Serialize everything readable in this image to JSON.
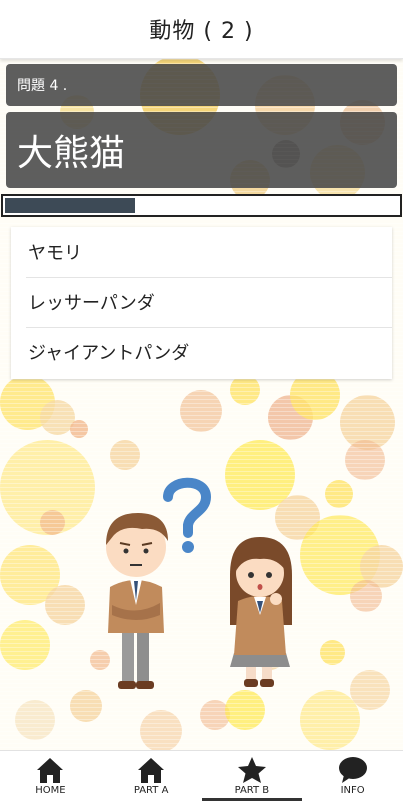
{
  "header": {
    "title": "動物 ( 2 )"
  },
  "quiz": {
    "number_label": "問題 4 .",
    "question": "大熊猫",
    "timer_remaining": 0.33,
    "answers": [
      {
        "label": "ヤモリ"
      },
      {
        "label": "レッサーパンダ"
      },
      {
        "label": "ジャイアントパンダ"
      }
    ]
  },
  "nav": {
    "items": [
      {
        "label": "HOME",
        "icon": "home-icon"
      },
      {
        "label": "PART A",
        "icon": "home-icon"
      },
      {
        "label": "PART B",
        "icon": "star-icon",
        "active": true
      },
      {
        "label": "INFO",
        "icon": "chat-bubble-icon"
      }
    ]
  },
  "colors": {
    "panel": "#484848",
    "timer_fill": "#3d4a56",
    "dots_yellow": "#ffe15a",
    "dots_peach": "#f2b98f"
  }
}
